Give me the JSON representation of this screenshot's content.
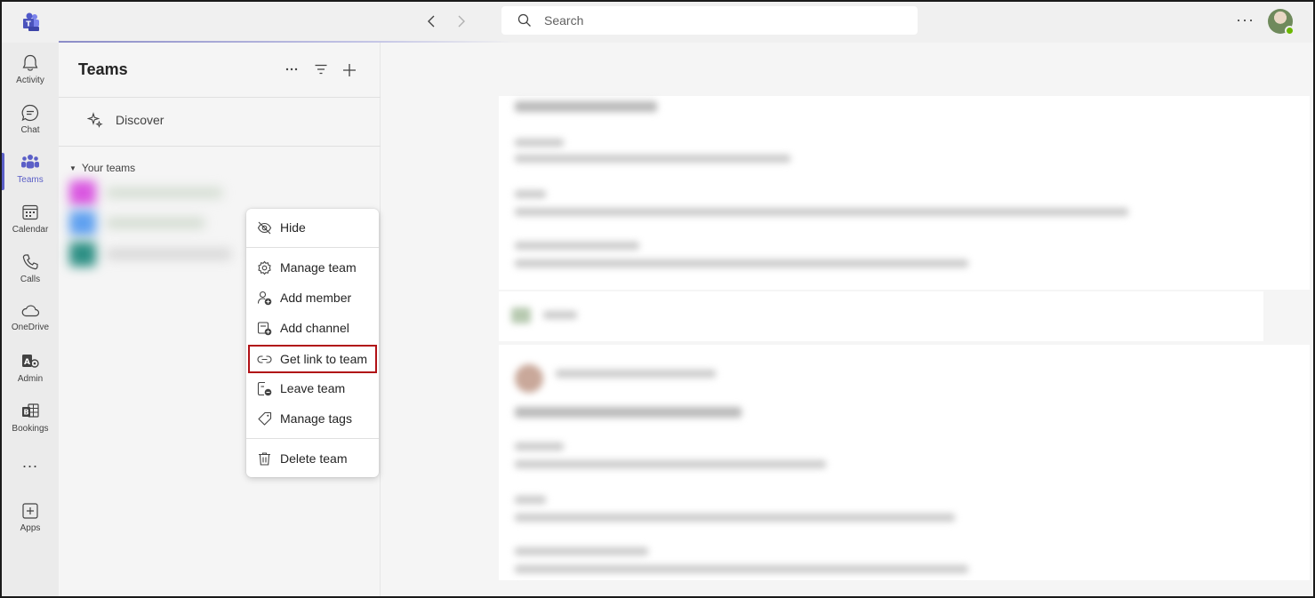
{
  "search": {
    "placeholder": "Search"
  },
  "rail": {
    "items": [
      {
        "label": "Activity",
        "icon": "bell-icon"
      },
      {
        "label": "Chat",
        "icon": "chat-icon"
      },
      {
        "label": "Teams",
        "icon": "teams-icon",
        "active": true
      },
      {
        "label": "Calendar",
        "icon": "calendar-icon"
      },
      {
        "label": "Calls",
        "icon": "phone-icon"
      },
      {
        "label": "OneDrive",
        "icon": "cloud-icon"
      },
      {
        "label": "Admin",
        "icon": "admin-icon"
      },
      {
        "label": "Bookings",
        "icon": "bookings-icon"
      },
      {
        "label": "Apps",
        "icon": "add-app-icon"
      }
    ],
    "more": "..."
  },
  "panel": {
    "title": "Teams",
    "discover": "Discover",
    "section": "Your teams"
  },
  "menu": {
    "hide": "Hide",
    "manage_team": "Manage team",
    "add_member": "Add member",
    "add_channel": "Add channel",
    "get_link": "Get link to team",
    "leave_team": "Leave team",
    "manage_tags": "Manage tags",
    "delete_team": "Delete team"
  },
  "colors": {
    "accent": "#5b5fc7",
    "highlight_outline": "#b11116"
  }
}
